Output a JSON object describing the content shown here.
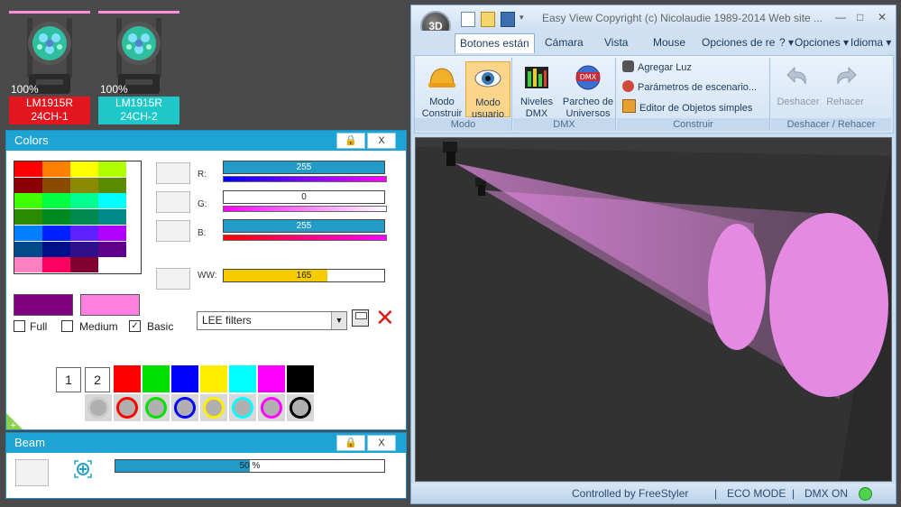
{
  "fixtures": [
    {
      "percent": "100%",
      "model": "LM1915R",
      "channel": "24CH-1",
      "label_color": "#e3161f"
    },
    {
      "percent": "100%",
      "model": "LM1915R",
      "channel": "24CH-2",
      "label_color": "#1fc8c8"
    }
  ],
  "colors_panel": {
    "title": "Colors",
    "lock_icon": "lock-icon",
    "close_label": "X",
    "grid_colors": [
      [
        "#ff0000",
        "#ff8000",
        "#ffff00",
        "#b0ff00"
      ],
      [
        "#8a0000",
        "#8a4a00",
        "#8a8a00",
        "#5a8a00"
      ],
      [
        "#40ff00",
        "#00ff40",
        "#00ff90",
        "#00ffff"
      ],
      [
        "#2a8a00",
        "#008a20",
        "#008a50",
        "#008a8a"
      ],
      [
        "#0080ff",
        "#0020ff",
        "#6020ff",
        "#b000ff"
      ],
      [
        "#004a8a",
        "#00108a",
        "#30108a",
        "#60008a"
      ],
      [
        "#ff80c0",
        "#ff0060",
        "#800030",
        "#ffffff"
      ]
    ],
    "sliders": [
      {
        "label": "R:",
        "value": "255",
        "fill": 1.0,
        "color": "#229bc8",
        "gradient": "linear-gradient(90deg,#0000ff,#ff00ff)"
      },
      {
        "label": "G:",
        "value": "0",
        "fill": 0.0,
        "color": "#229bc8",
        "gradient": "linear-gradient(90deg,#ff00ff,#ffffff)"
      },
      {
        "label": "B:",
        "value": "255",
        "fill": 1.0,
        "color": "#229bc8",
        "gradient": "linear-gradient(90deg,#ff0000,#ff00ff)"
      }
    ],
    "ww": {
      "label": "WW:",
      "value": "165",
      "fill": 0.647,
      "color": "#f4cc00"
    },
    "swatch_left": "#800080",
    "swatch_right": "#ff80e0",
    "options": [
      {
        "label": "Full",
        "checked": false
      },
      {
        "label": "Medium",
        "checked": false
      },
      {
        "label": "Basic",
        "checked": true
      }
    ],
    "filter_select": "LEE filters",
    "pages": [
      "1",
      "2"
    ],
    "palette": [
      "#ff0000",
      "#00e000",
      "#0000ff",
      "#ffee00",
      "#00ffff",
      "#ff00ff",
      "#000000"
    ],
    "rings": [
      "#cccccc",
      "#ff0000",
      "#00e000",
      "#0000ff",
      "#ffee00",
      "#00ffff",
      "#ff00ff",
      "#000000"
    ]
  },
  "beam_panel": {
    "title": "Beam",
    "close_label": "X",
    "value": "50",
    "unit": "%",
    "fill": 0.5
  },
  "window": {
    "title": "Easy View   Copyright (c) Nicolaudie 1989-2014   Web site ...",
    "logo": "3D",
    "tabs": [
      "Botones están",
      "Cámara",
      "Vista",
      "Mouse",
      "Opciones de re"
    ],
    "menu_help": "?",
    "menu_options": "Opciones",
    "menu_language": "Idioma",
    "groups": {
      "modo": {
        "label": "Modo",
        "buttons": [
          {
            "line1": "Modo",
            "line2": "Construir"
          },
          {
            "line1": "Modo",
            "line2": "usuario"
          }
        ]
      },
      "dmx": {
        "label": "DMX",
        "buttons": [
          {
            "line1": "Niveles",
            "line2": "DMX"
          },
          {
            "line1": "Parcheo de",
            "line2": "Universos"
          }
        ],
        "icon_text": "DMX"
      },
      "construir": {
        "label": "Construir",
        "items": [
          "Agregar Luz",
          "Parámetros de escenario...",
          "Editor de Objetos simples"
        ]
      },
      "undo": {
        "label": "Deshacer / Rehacer",
        "undo": "Deshacer",
        "redo": "Rehacer"
      }
    },
    "status": {
      "controlled": "Controlled by FreeStyler",
      "eco": "ECO MODE",
      "dmx": "DMX ON",
      "sep": "|"
    },
    "beam_color": "#e58ae3"
  }
}
